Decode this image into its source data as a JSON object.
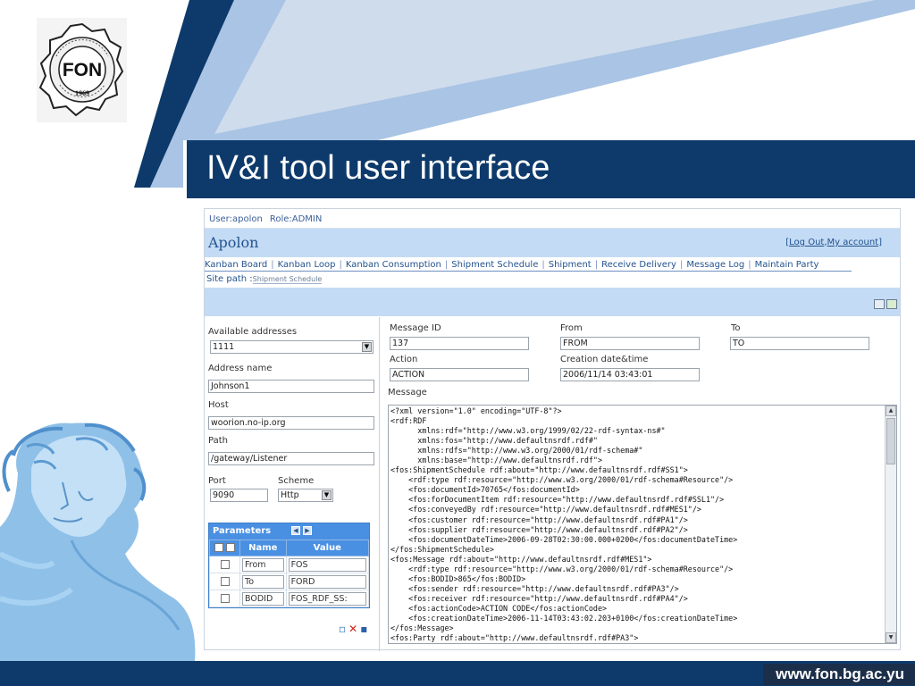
{
  "slide": {
    "title": "IV&I tool user interface",
    "footer_url": "www.fon.bg.ac.yu",
    "logo": {
      "initials": "FON",
      "year": "1969",
      "icon": "university-seal-icon"
    },
    "colors": {
      "navy": "#0d3a6b",
      "light_blue": "#a9c4e4",
      "app_blue": "#c3dbf5",
      "link": "#24538f"
    }
  },
  "app": {
    "user": "User:apolon",
    "role": "Role:ADMIN",
    "brand": "Apolon",
    "account_open": "[",
    "logout": "Log Out",
    "account_sep": ",",
    "my_account": "My account",
    "account_close": "]",
    "nav": [
      "Kanban Board",
      "Kanban Loop",
      "Kanban Consumption",
      "Shipment Schedule",
      "Shipment",
      "Receive Delivery",
      "Message Log",
      "Maintain Party"
    ],
    "nav_sep": "|",
    "site_path_label": "Site path :",
    "site_path_value": "Shipment Schedule",
    "left": {
      "available_addresses_label": "Available addresses",
      "available_addresses_value": "1111",
      "address_name_label": "Address name",
      "address_name_value": "Johnson1",
      "host_label": "Host",
      "host_value": "woorion.no-ip.org",
      "path_label": "Path",
      "path_value": "/gateway/Listener",
      "port_label": "Port",
      "port_value": "9090",
      "scheme_label": "Scheme",
      "scheme_value": "Http",
      "parameters": {
        "title": "Parameters",
        "col_name": "Name",
        "col_value": "Value",
        "rows": [
          {
            "name": "From",
            "value": "FOS"
          },
          {
            "name": "To",
            "value": "FORD"
          },
          {
            "name": "BODID",
            "value": "FOS_RDF_SS:"
          }
        ]
      }
    },
    "right": {
      "message_id_label": "Message ID",
      "message_id_value": "137",
      "from_label": "From",
      "from_value": "FROM",
      "to_label": "To",
      "to_value": "TO",
      "action_label": "Action",
      "action_value": "ACTION",
      "creation_label": "Creation date&time",
      "creation_value": "2006/11/14 03:43:01",
      "message_label": "Message",
      "message_lines": [
        "<?xml version=\"1.0\" encoding=\"UTF-8\"?>",
        "<rdf:RDF",
        "      xmlns:rdf=\"http://www.w3.org/1999/02/22-rdf-syntax-ns#\"",
        "      xmlns:fos=\"http://www.defaultnsrdf.rdf#\"",
        "      xmlns:rdfs=\"http://www.w3.org/2000/01/rdf-schema#\"",
        "      xmlns:base=\"http://www.defaultnsrdf.rdf\">",
        "<fos:ShipmentSchedule rdf:about=\"http://www.defaultnsrdf.rdf#SS1\">",
        "    <rdf:type rdf:resource=\"http://www.w3.org/2000/01/rdf-schema#Resource\"/>",
        "    <fos:documentId>70765</fos:documentId>",
        "    <fos:forDocumentItem rdf:resource=\"http://www.defaultnsrdf.rdf#SSL1\"/>",
        "    <fos:conveyedBy rdf:resource=\"http://www.defaultnsrdf.rdf#MES1\"/>",
        "    <fos:customer rdf:resource=\"http://www.defaultnsrdf.rdf#PA1\"/>",
        "    <fos:supplier rdf:resource=\"http://www.defaultnsrdf.rdf#PA2\"/>",
        "    <fos:documentDateTime>2006-09-28T02:30:00.000+0200</fos:documentDateTime>",
        "</fos:ShipmentSchedule>",
        "<fos:Message rdf:about=\"http://www.defaultnsrdf.rdf#MES1\">",
        "    <rdf:type rdf:resource=\"http://www.w3.org/2000/01/rdf-schema#Resource\"/>",
        "    <fos:BODID>865</fos:BODID>",
        "    <fos:sender rdf:resource=\"http://www.defaultnsrdf.rdf#PA3\"/>",
        "    <fos:receiver rdf:resource=\"http://www.defaultnsrdf.rdf#PA4\"/>",
        "    <fos:actionCode>ACTION CODE</fos:actionCode>",
        "    <fos:creationDateTime>2006-11-14T03:43:02.203+0100</fos:creationDateTime>",
        "</fos:Message>",
        "<fos:Party rdf:about=\"http://www.defaultnsrdf.rdf#PA3\">"
      ]
    }
  }
}
